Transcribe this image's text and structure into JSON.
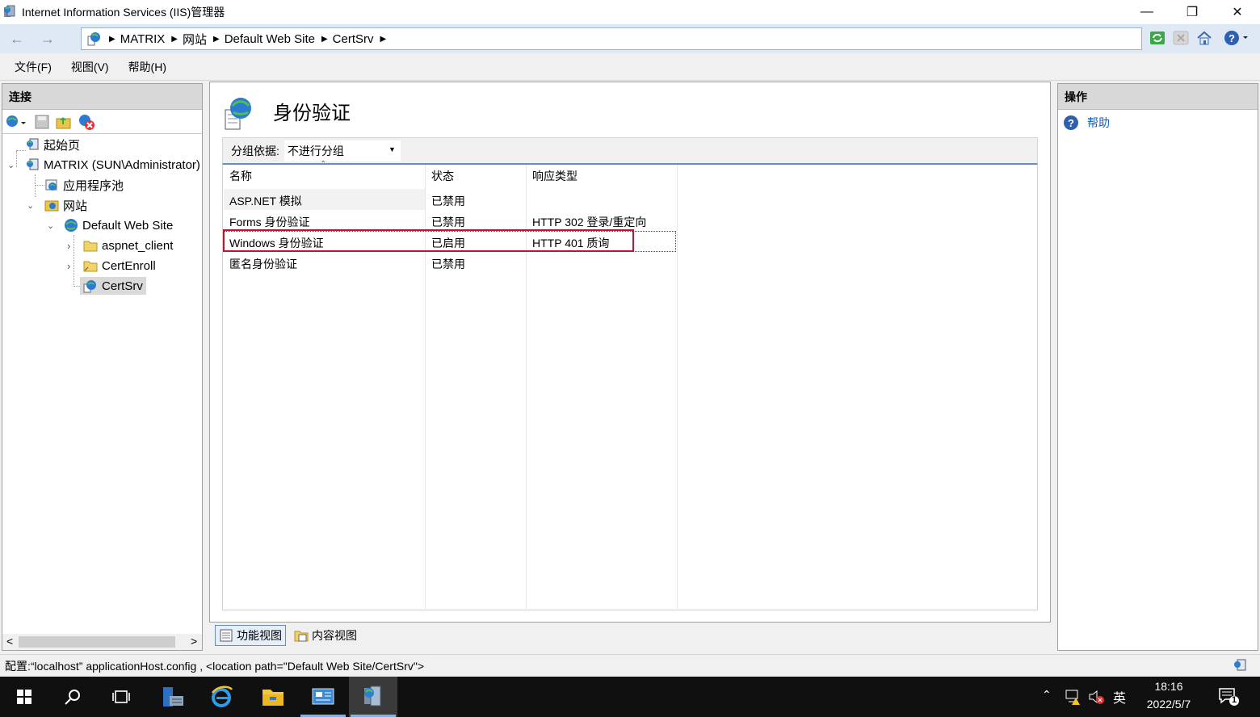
{
  "window": {
    "title": "Internet Information Services (IIS)管理器",
    "min_glyph": "—",
    "max_glyph": "❐",
    "close_glyph": "✕"
  },
  "address": {
    "back_glyph": "←",
    "forward_glyph": "→",
    "sep_glyph": "▶",
    "crumbs": [
      "MATRIX",
      "网站",
      "Default Web Site",
      "CertSrv"
    ]
  },
  "menu": {
    "file": "文件(F)",
    "view": "视图(V)",
    "help": "帮助(H)"
  },
  "connections": {
    "header": "连接",
    "tree": {
      "start_page": "起始页",
      "server": "MATRIX (SUN\\Administrator)",
      "app_pools": "应用程序池",
      "sites": "网站",
      "default_site": "Default Web Site",
      "aspnet_client": "aspnet_client",
      "cert_enroll": "CertEnroll",
      "cert_srv": "CertSrv"
    },
    "scroll_left": "<",
    "scroll_right": ">"
  },
  "feature": {
    "title": "身份验证",
    "group_label": "分组依据:",
    "group_value": "不进行分组",
    "columns": {
      "name": "名称",
      "status": "状态",
      "response": "响应类型"
    },
    "rows": [
      {
        "name": "ASP.NET 模拟",
        "status": "已禁用",
        "response": ""
      },
      {
        "name": "Forms 身份验证",
        "status": "已禁用",
        "response": "HTTP 302 登录/重定向"
      },
      {
        "name": "Windows 身份验证",
        "status": "已启用",
        "response": "HTTP 401 质询"
      },
      {
        "name": "匿名身份验证",
        "status": "已禁用",
        "response": ""
      }
    ]
  },
  "bottom_tabs": {
    "features": "功能视图",
    "content": "内容视图"
  },
  "actions": {
    "header": "操作",
    "help": "帮助"
  },
  "status": {
    "text": "配置:“localhost” applicationHost.config , <location path=\"Default Web Site/CertSrv\">"
  },
  "taskbar": {
    "time": "18:16",
    "date": "2022/5/7",
    "ime": "英",
    "notif_count": "1"
  },
  "colors": {
    "accent": "#1a5fb4",
    "highlight": "#c8102e",
    "selected": "#d9d9d9"
  }
}
